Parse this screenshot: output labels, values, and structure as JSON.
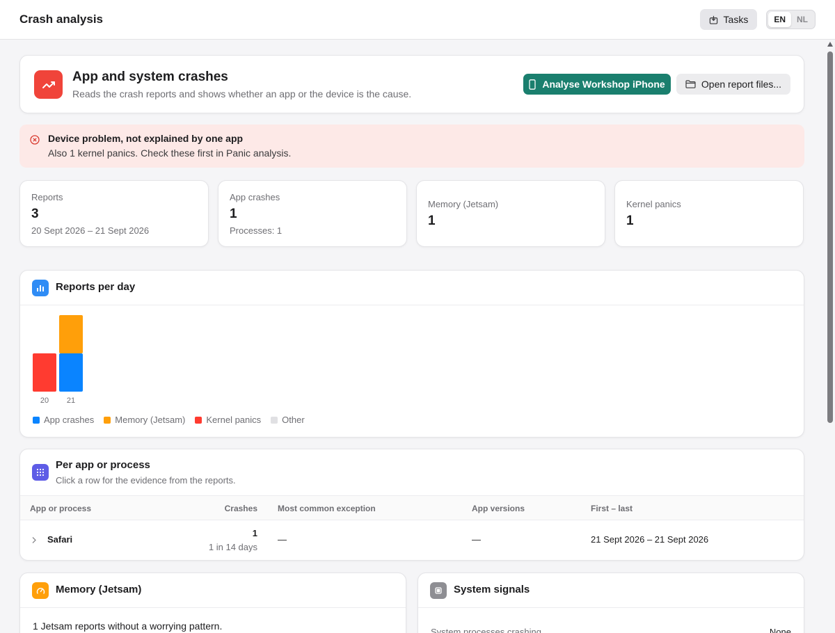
{
  "topbar": {
    "title": "Crash analysis",
    "tasks_label": "Tasks",
    "languages": [
      "EN",
      "NL"
    ],
    "active_language": "EN"
  },
  "hero": {
    "title": "App and system crashes",
    "subtitle": "Reads the crash reports and shows whether an app or the device is the cause.",
    "primary_button": "Analyse Workshop iPhone",
    "secondary_button": "Open report files..."
  },
  "alert": {
    "title": "Device problem, not explained by one app",
    "text": "Also 1 kernel panics. Check these first in Panic analysis."
  },
  "stats": [
    {
      "label": "Reports",
      "value": "3",
      "sub": "20 Sept 2026 – 21 Sept 2026"
    },
    {
      "label": "App crashes",
      "value": "1",
      "sub": "Processes: 1"
    },
    {
      "label": "Memory (Jetsam)",
      "value": "1",
      "sub": ""
    },
    {
      "label": "Kernel panics",
      "value": "1",
      "sub": ""
    }
  ],
  "chart_section": {
    "title": "Reports per day",
    "legend": [
      "App crashes",
      "Memory (Jetsam)",
      "Kernel panics",
      "Other"
    ]
  },
  "chart_data": {
    "type": "bar",
    "stacked": true,
    "title": "Reports per day",
    "categories": [
      "20",
      "21"
    ],
    "series": [
      {
        "name": "App crashes",
        "values": [
          0,
          1
        ],
        "color": "#0a84ff"
      },
      {
        "name": "Memory (Jetsam)",
        "values": [
          0,
          1
        ],
        "color": "#ff9f0a"
      },
      {
        "name": "Kernel panics",
        "values": [
          1,
          0
        ],
        "color": "#ff3b30"
      },
      {
        "name": "Other",
        "values": [
          0,
          0
        ],
        "color": "#e0e0e3"
      }
    ],
    "ylim": [
      0,
      2
    ],
    "grid": false,
    "legend_position": "bottom-left"
  },
  "table": {
    "title": "Per app or process",
    "subtitle": "Click a row for the evidence from the reports.",
    "columns": [
      "App or process",
      "Crashes",
      "Most common exception",
      "App versions",
      "First – last"
    ],
    "rows": [
      {
        "name": "Safari",
        "crashes": "1",
        "rate": "1 in 14 days",
        "exception": "—",
        "versions": "—",
        "range": "21 Sept 2026 – 21 Sept 2026"
      }
    ]
  },
  "memory": {
    "title": "Memory (Jetsam)",
    "text": "1 Jetsam reports without a worrying pattern."
  },
  "system": {
    "title": "System signals",
    "label": "System processes crashing",
    "value": "None"
  },
  "colors": {
    "accent": "#1a7f6e",
    "danger": "#f0443a",
    "alert_bg": "#fde9e7"
  }
}
